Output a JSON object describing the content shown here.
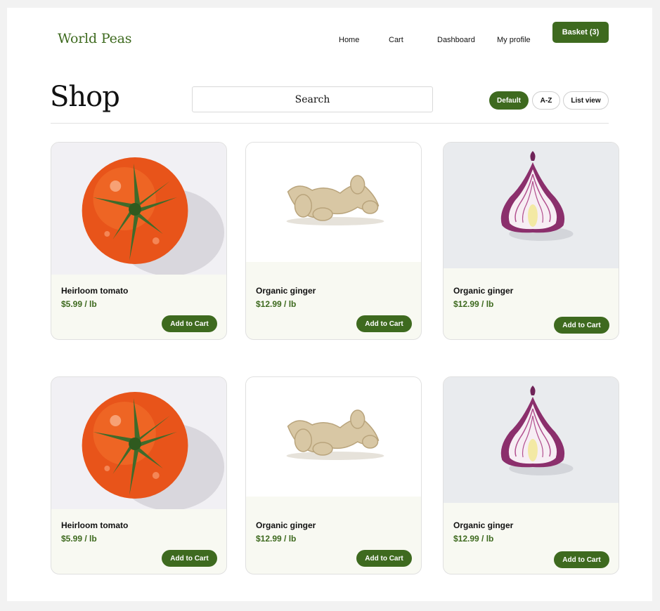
{
  "header": {
    "logo": "World Peas",
    "nav": {
      "home": "Home",
      "cart": "Cart",
      "dashboard": "Dashboard",
      "profile": "My profile"
    },
    "basket_label": "Basket (3)"
  },
  "shop": {
    "title": "Shop",
    "search_placeholder": "Search",
    "sort_options": [
      "Default",
      "A-Z",
      "List view"
    ],
    "selected_sort": "Default"
  },
  "products": [
    {
      "name": "Heirloom tomato",
      "price": "$5.99 / lb",
      "button": "Add to Cart",
      "image": "tomato"
    },
    {
      "name": "Organic ginger",
      "price": "$12.99 / lb",
      "button": "Add to Cart",
      "image": "ginger"
    },
    {
      "name": "Organic ginger",
      "price": "$12.99 / lb",
      "button": "Add to Cart",
      "image": "red-onion"
    },
    {
      "name": "Heirloom tomato",
      "price": "$5.99 / lb",
      "button": "Add to Cart",
      "image": "tomato"
    },
    {
      "name": "Organic ginger",
      "price": "$12.99 / lb",
      "button": "Add to Cart",
      "image": "ginger"
    },
    {
      "name": "Organic ginger",
      "price": "$12.99 / lb",
      "button": "Add to Cart",
      "image": "red-onion"
    }
  ],
  "colors": {
    "brand_green": "#3e6a1f",
    "card_background": "#f8f9f2"
  }
}
